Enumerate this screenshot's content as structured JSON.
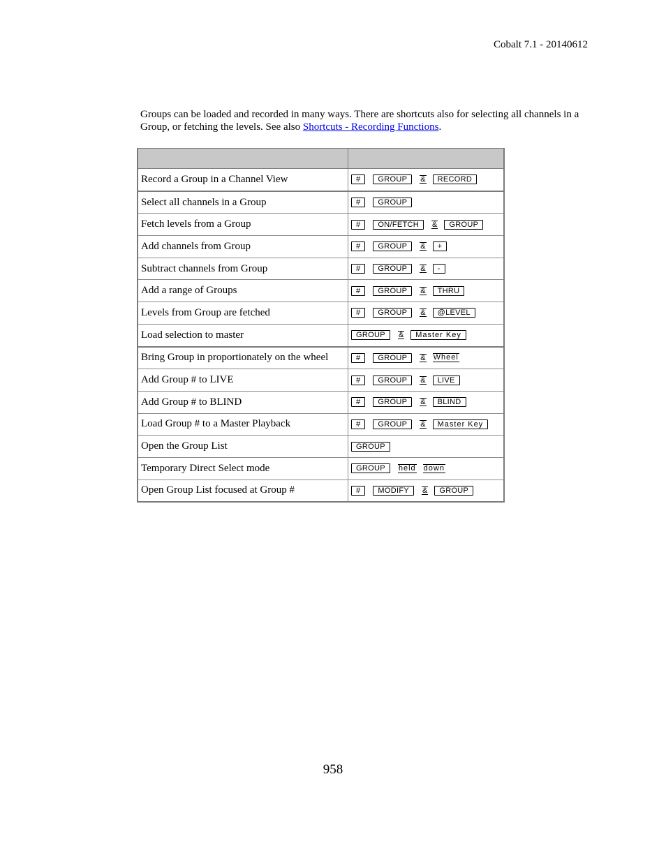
{
  "header": {
    "title": "Cobalt 7.1 - 20140612"
  },
  "intro": {
    "text": "Groups can be loaded and recorded in many ways. There are shortcuts also for selecting all channels in a Group, or fetching the levels. See also ",
    "link_label": "Shortcuts - Recording Functions",
    "after_link": "."
  },
  "table": {
    "headers": [
      "",
      ""
    ],
    "rows": [
      {
        "description": "Record a Group in a Channel View",
        "keys": [
          {
            "t": "key",
            "v": "#"
          },
          {
            "t": "key",
            "v": "GROUP"
          },
          {
            "t": "amp",
            "v": "&"
          },
          {
            "t": "key",
            "v": "RECORD"
          }
        ]
      },
      {
        "description": "Select all channels in a Group",
        "keys": [
          {
            "t": "key",
            "v": "#"
          },
          {
            "t": "key",
            "v": "GROUP"
          }
        ]
      },
      {
        "description": "Fetch levels from a Group",
        "keys": [
          {
            "t": "key",
            "v": "#"
          },
          {
            "t": "key",
            "v": "ON/FETCH"
          },
          {
            "t": "amp",
            "v": "&"
          },
          {
            "t": "key",
            "v": "GROUP"
          }
        ]
      },
      {
        "description": "Add channels from Group",
        "keys": [
          {
            "t": "key",
            "v": "#"
          },
          {
            "t": "key",
            "v": "GROUP"
          },
          {
            "t": "amp",
            "v": "&"
          },
          {
            "t": "key",
            "v": "+"
          }
        ]
      },
      {
        "description": "Subtract channels from Group",
        "keys": [
          {
            "t": "key",
            "v": "#"
          },
          {
            "t": "key",
            "v": "GROUP"
          },
          {
            "t": "amp",
            "v": "&"
          },
          {
            "t": "key",
            "v": "-"
          }
        ]
      },
      {
        "description": "Add a range of Groups",
        "keys": [
          {
            "t": "key",
            "v": "#"
          },
          {
            "t": "key",
            "v": "GROUP"
          },
          {
            "t": "amp",
            "v": "&"
          },
          {
            "t": "key",
            "v": "THRU"
          }
        ]
      },
      {
        "description": "Levels from Group are fetched",
        "keys": [
          {
            "t": "key",
            "v": "#"
          },
          {
            "t": "key",
            "v": "GROUP"
          },
          {
            "t": "amp",
            "v": "&"
          },
          {
            "t": "key",
            "v": "@LEVEL"
          }
        ]
      },
      {
        "description": "Load selection to master",
        "keys": [
          {
            "t": "key",
            "v": "GROUP"
          },
          {
            "t": "amp",
            "v": "&"
          },
          {
            "t": "keywide",
            "v": "Master Key"
          }
        ]
      },
      {
        "description": "Bring Group in proportionately on the wheel",
        "keys": [
          {
            "t": "key",
            "v": "#"
          },
          {
            "t": "key",
            "v": "GROUP"
          },
          {
            "t": "amp",
            "v": "&"
          },
          {
            "t": "soft",
            "v": "Wheel"
          }
        ]
      },
      {
        "description": "Add  Group # to LIVE",
        "keys": [
          {
            "t": "key",
            "v": "#"
          },
          {
            "t": "key",
            "v": "GROUP"
          },
          {
            "t": "amp",
            "v": "&"
          },
          {
            "t": "key",
            "v": "LIVE"
          }
        ]
      },
      {
        "description": "Add Group # to BLIND",
        "keys": [
          {
            "t": "key",
            "v": "#"
          },
          {
            "t": "key",
            "v": "GROUP"
          },
          {
            "t": "amp",
            "v": "&"
          },
          {
            "t": "key",
            "v": "BLIND"
          }
        ]
      },
      {
        "description": "Load Group # to a Master Playback",
        "keys": [
          {
            "t": "key",
            "v": "#"
          },
          {
            "t": "key",
            "v": "GROUP"
          },
          {
            "t": "amp",
            "v": "&"
          },
          {
            "t": "keywide",
            "v": "Master Key"
          }
        ]
      },
      {
        "description": "Open the Group List",
        "keys": [
          {
            "t": "key",
            "v": "GROUP"
          }
        ]
      },
      {
        "description": "Temporary Direct Select mode",
        "keys": [
          {
            "t": "key",
            "v": "GROUP"
          },
          {
            "t": "soft",
            "v": "held"
          },
          {
            "t": "soft",
            "v": "down"
          }
        ]
      },
      {
        "description": "Open Group List focused at Group #",
        "keys": [
          {
            "t": "key",
            "v": "#"
          },
          {
            "t": "key",
            "v": "MODIFY"
          },
          {
            "t": "amp",
            "v": "&"
          },
          {
            "t": "key",
            "v": "GROUP"
          }
        ]
      }
    ]
  },
  "footer": {
    "page_number": "958"
  }
}
